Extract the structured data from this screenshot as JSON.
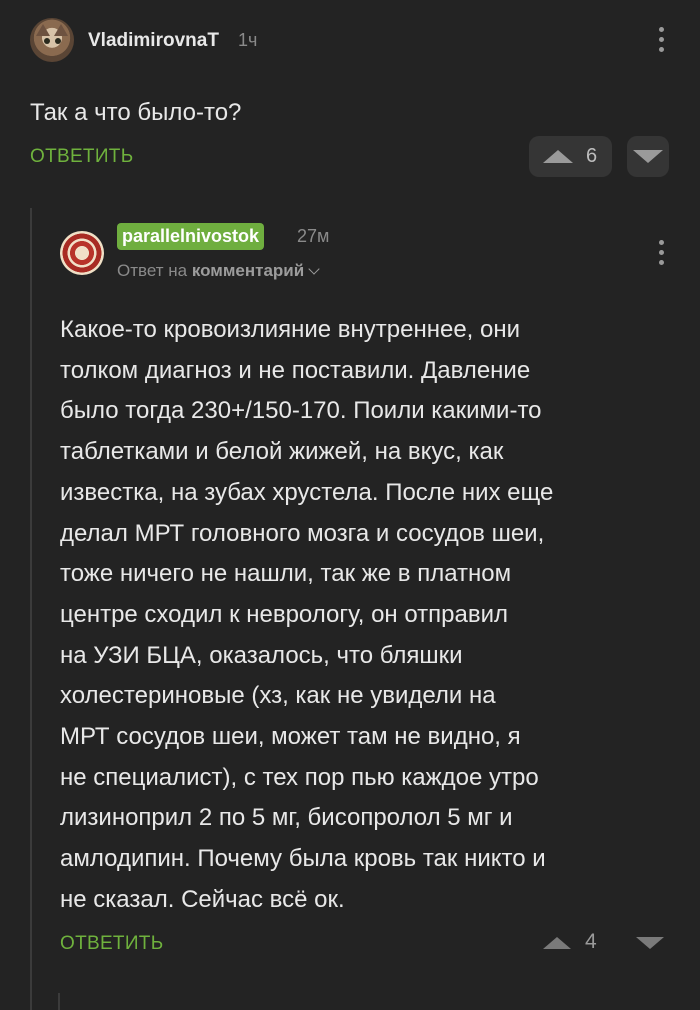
{
  "top_comment": {
    "username": "VladimirovnaT",
    "time": "1ч",
    "text": "Так а что было-то?",
    "reply_label": "ОТВЕТИТЬ",
    "votes": "6"
  },
  "reply_comment": {
    "username": "parallelnivostok",
    "time": "27м",
    "reply_to_prefix": "Ответ на",
    "reply_to_target": "комментарий",
    "lines": [
      "Какое-то кровоизлияние внутреннее, они",
      "толком диагноз и не поставили. Давление",
      "было тогда 230+/150-170. Поили какими-то",
      "таблетками и белой жижей, на вкус, как",
      "известка, на зубах хрустела. После них еще",
      "делал МРТ головного мозга и сосудов шеи,",
      "тоже ничего не нашли, так же в платном",
      "центре сходил к неврологу, он отправил",
      "на УЗИ БЦА, оказалось, что бляшки",
      "холестериновые (хз, как не увидели на",
      "МРТ сосудов шеи, может там не видно, я",
      "не специалист), с тех пор пью каждое утро",
      "лизиноприл 2 по 5 мг, бисопролол 5 мг и",
      "амлодипин. Почему была кровь так никто и",
      "не сказал. Сейчас всё ок."
    ],
    "reply_label": "ОТВЕТИТЬ",
    "votes": "4"
  },
  "colors": {
    "background": "#232323",
    "accent_green": "#6fb23d",
    "text": "#e8e8e8",
    "muted": "#8a8a8a"
  },
  "icons": [
    "more-vertical-icon",
    "upvote-arrow-icon",
    "downvote-arrow-icon",
    "chevron-down-icon"
  ]
}
